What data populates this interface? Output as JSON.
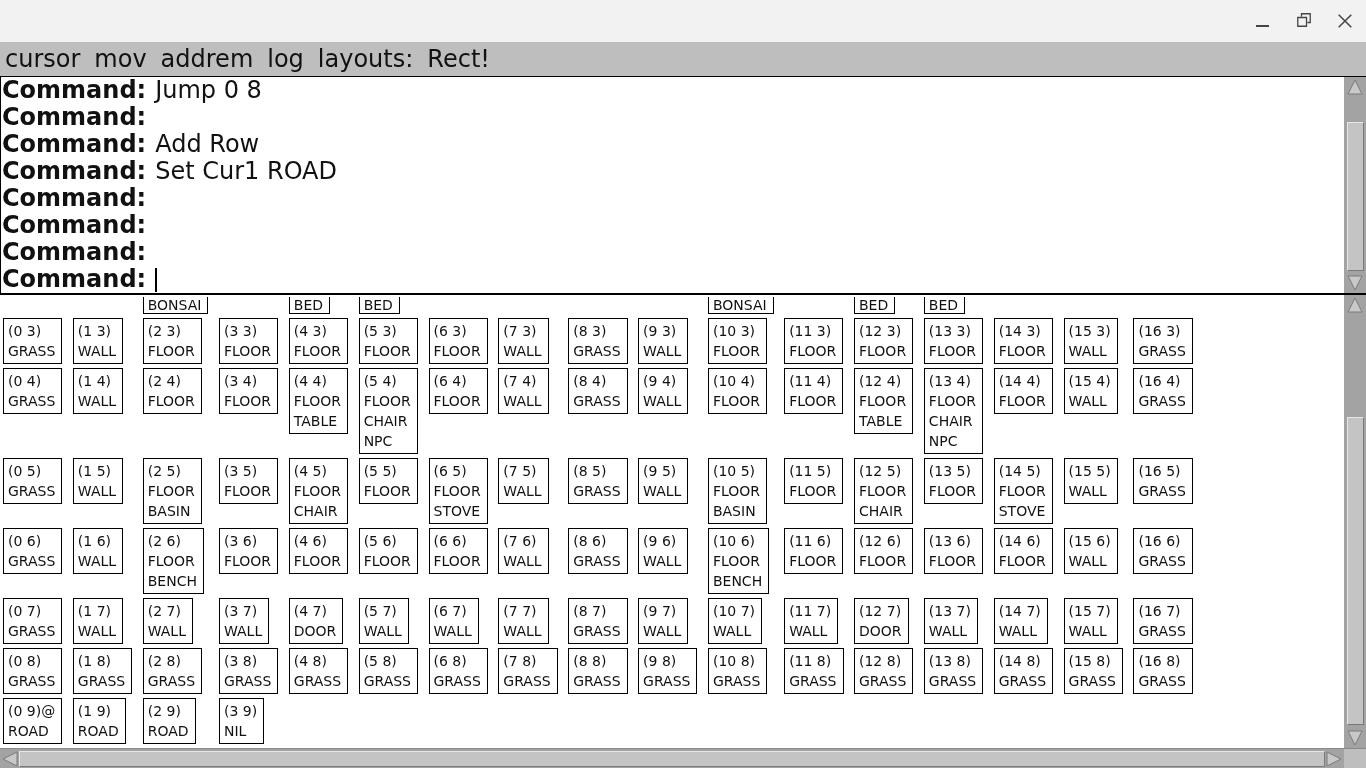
{
  "menu_bar": {
    "items": [
      {
        "label": "cursor"
      },
      {
        "label": "mov"
      },
      {
        "label": "addrem"
      },
      {
        "label": "log"
      },
      {
        "label": "layouts:"
      },
      {
        "label": "Rect!"
      }
    ]
  },
  "command_log": {
    "lines": [
      {
        "prompt": "Command:",
        "command": "Jump 0 8"
      },
      {
        "prompt": "Command:"
      },
      {
        "prompt": "Command:",
        "command": "Add Row"
      },
      {
        "prompt": "Command:",
        "command": "Set Cur1 ROAD"
      },
      {
        "prompt": "Command:"
      },
      {
        "prompt": "Command:"
      },
      {
        "prompt": "Command:"
      }
    ],
    "input": {
      "prompt": "Command:",
      "focused": true
    }
  },
  "map": {
    "rows": [
      [
        {
          "coords": "(0 3)",
          "lines": [
            "GRASS"
          ]
        },
        {
          "coords": "(1 3)",
          "lines": [
            "WALL"
          ]
        },
        {
          "coords": "(2 3)",
          "lines": [
            "FLOOR"
          ],
          "clipped_cell_above": {
            "lines": [
              "BONSAI"
            ]
          }
        },
        {
          "coords": "(3 3)",
          "lines": [
            "FLOOR"
          ]
        },
        {
          "coords": "(4 3)",
          "lines": [
            "FLOOR"
          ],
          "clipped_cell_above": {
            "lines": [
              "BED"
            ]
          }
        },
        {
          "coords": "(5 3)",
          "lines": [
            "FLOOR"
          ],
          "clipped_cell_above": {
            "lines": [
              "BED"
            ]
          }
        },
        {
          "coords": "(6 3)",
          "lines": [
            "FLOOR"
          ]
        },
        {
          "coords": "(7 3)",
          "lines": [
            "WALL"
          ]
        },
        {
          "coords": "(8 3)",
          "lines": [
            "GRASS"
          ]
        },
        {
          "coords": "(9 3)",
          "lines": [
            "WALL"
          ]
        },
        {
          "coords": "(10 3)",
          "lines": [
            "FLOOR"
          ],
          "clipped_cell_above": {
            "lines": [
              "BONSAI"
            ]
          }
        },
        {
          "coords": "(11 3)",
          "lines": [
            "FLOOR"
          ]
        },
        {
          "coords": "(12 3)",
          "lines": [
            "FLOOR"
          ],
          "clipped_cell_above": {
            "lines": [
              "BED"
            ]
          }
        },
        {
          "coords": "(13 3)",
          "lines": [
            "FLOOR"
          ],
          "clipped_cell_above": {
            "lines": [
              "BED"
            ]
          }
        },
        {
          "coords": "(14 3)",
          "lines": [
            "FLOOR"
          ]
        },
        {
          "coords": "(15 3)",
          "lines": [
            "WALL"
          ]
        },
        {
          "coords": "(16 3)",
          "lines": [
            "GRASS"
          ]
        }
      ],
      [
        {
          "coords": "(0 4)",
          "lines": [
            "GRASS"
          ]
        },
        {
          "coords": "(1 4)",
          "lines": [
            "WALL"
          ]
        },
        {
          "coords": "(2 4)",
          "lines": [
            "FLOOR"
          ]
        },
        {
          "coords": "(3 4)",
          "lines": [
            "FLOOR"
          ]
        },
        {
          "coords": "(4 4)",
          "lines": [
            "FLOOR",
            "TABLE"
          ]
        },
        {
          "coords": "(5 4)",
          "lines": [
            "FLOOR",
            "CHAIR",
            "NPC"
          ]
        },
        {
          "coords": "(6 4)",
          "lines": [
            "FLOOR"
          ]
        },
        {
          "coords": "(7 4)",
          "lines": [
            "WALL"
          ]
        },
        {
          "coords": "(8 4)",
          "lines": [
            "GRASS"
          ]
        },
        {
          "coords": "(9 4)",
          "lines": [
            "WALL"
          ]
        },
        {
          "coords": "(10 4)",
          "lines": [
            "FLOOR"
          ]
        },
        {
          "coords": "(11 4)",
          "lines": [
            "FLOOR"
          ]
        },
        {
          "coords": "(12 4)",
          "lines": [
            "FLOOR",
            "TABLE"
          ]
        },
        {
          "coords": "(13 4)",
          "lines": [
            "FLOOR",
            "CHAIR",
            "NPC"
          ]
        },
        {
          "coords": "(14 4)",
          "lines": [
            "FLOOR"
          ]
        },
        {
          "coords": "(15 4)",
          "lines": [
            "WALL"
          ]
        },
        {
          "coords": "(16 4)",
          "lines": [
            "GRASS"
          ]
        }
      ],
      [
        {
          "coords": "(0 5)",
          "lines": [
            "GRASS"
          ]
        },
        {
          "coords": "(1 5)",
          "lines": [
            "WALL"
          ]
        },
        {
          "coords": "(2 5)",
          "lines": [
            "FLOOR",
            "BASIN"
          ]
        },
        {
          "coords": "(3 5)",
          "lines": [
            "FLOOR"
          ]
        },
        {
          "coords": "(4 5)",
          "lines": [
            "FLOOR",
            "CHAIR"
          ]
        },
        {
          "coords": "(5 5)",
          "lines": [
            "FLOOR"
          ]
        },
        {
          "coords": "(6 5)",
          "lines": [
            "FLOOR",
            "STOVE"
          ]
        },
        {
          "coords": "(7 5)",
          "lines": [
            "WALL"
          ]
        },
        {
          "coords": "(8 5)",
          "lines": [
            "GRASS"
          ]
        },
        {
          "coords": "(9 5)",
          "lines": [
            "WALL"
          ]
        },
        {
          "coords": "(10 5)",
          "lines": [
            "FLOOR",
            "BASIN"
          ]
        },
        {
          "coords": "(11 5)",
          "lines": [
            "FLOOR"
          ]
        },
        {
          "coords": "(12 5)",
          "lines": [
            "FLOOR",
            "CHAIR"
          ]
        },
        {
          "coords": "(13 5)",
          "lines": [
            "FLOOR"
          ]
        },
        {
          "coords": "(14 5)",
          "lines": [
            "FLOOR",
            "STOVE"
          ]
        },
        {
          "coords": "(15 5)",
          "lines": [
            "WALL"
          ]
        },
        {
          "coords": "(16 5)",
          "lines": [
            "GRASS"
          ]
        }
      ],
      [
        {
          "coords": "(0 6)",
          "lines": [
            "GRASS"
          ]
        },
        {
          "coords": "(1 6)",
          "lines": [
            "WALL"
          ]
        },
        {
          "coords": "(2 6)",
          "lines": [
            "FLOOR",
            "BENCH"
          ]
        },
        {
          "coords": "(3 6)",
          "lines": [
            "FLOOR"
          ]
        },
        {
          "coords": "(4 6)",
          "lines": [
            "FLOOR"
          ]
        },
        {
          "coords": "(5 6)",
          "lines": [
            "FLOOR"
          ]
        },
        {
          "coords": "(6 6)",
          "lines": [
            "FLOOR"
          ]
        },
        {
          "coords": "(7 6)",
          "lines": [
            "WALL"
          ]
        },
        {
          "coords": "(8 6)",
          "lines": [
            "GRASS"
          ]
        },
        {
          "coords": "(9 6)",
          "lines": [
            "WALL"
          ]
        },
        {
          "coords": "(10 6)",
          "lines": [
            "FLOOR",
            "BENCH"
          ]
        },
        {
          "coords": "(11 6)",
          "lines": [
            "FLOOR"
          ]
        },
        {
          "coords": "(12 6)",
          "lines": [
            "FLOOR"
          ]
        },
        {
          "coords": "(13 6)",
          "lines": [
            "FLOOR"
          ]
        },
        {
          "coords": "(14 6)",
          "lines": [
            "FLOOR"
          ]
        },
        {
          "coords": "(15 6)",
          "lines": [
            "WALL"
          ]
        },
        {
          "coords": "(16 6)",
          "lines": [
            "GRASS"
          ]
        }
      ],
      [
        {
          "coords": "(0 7)",
          "lines": [
            "GRASS"
          ]
        },
        {
          "coords": "(1 7)",
          "lines": [
            "WALL"
          ]
        },
        {
          "coords": "(2 7)",
          "lines": [
            "WALL"
          ]
        },
        {
          "coords": "(3 7)",
          "lines": [
            "WALL"
          ]
        },
        {
          "coords": "(4 7)",
          "lines": [
            "DOOR"
          ]
        },
        {
          "coords": "(5 7)",
          "lines": [
            "WALL"
          ]
        },
        {
          "coords": "(6 7)",
          "lines": [
            "WALL"
          ]
        },
        {
          "coords": "(7 7)",
          "lines": [
            "WALL"
          ]
        },
        {
          "coords": "(8 7)",
          "lines": [
            "GRASS"
          ]
        },
        {
          "coords": "(9 7)",
          "lines": [
            "WALL"
          ]
        },
        {
          "coords": "(10 7)",
          "lines": [
            "WALL"
          ]
        },
        {
          "coords": "(11 7)",
          "lines": [
            "WALL"
          ]
        },
        {
          "coords": "(12 7)",
          "lines": [
            "DOOR"
          ]
        },
        {
          "coords": "(13 7)",
          "lines": [
            "WALL"
          ]
        },
        {
          "coords": "(14 7)",
          "lines": [
            "WALL"
          ]
        },
        {
          "coords": "(15 7)",
          "lines": [
            "WALL"
          ]
        },
        {
          "coords": "(16 7)",
          "lines": [
            "GRASS"
          ]
        }
      ],
      [
        {
          "coords": "(0 8)",
          "lines": [
            "GRASS"
          ]
        },
        {
          "coords": "(1 8)",
          "lines": [
            "GRASS"
          ]
        },
        {
          "coords": "(2 8)",
          "lines": [
            "GRASS"
          ]
        },
        {
          "coords": "(3 8)",
          "lines": [
            "GRASS"
          ]
        },
        {
          "coords": "(4 8)",
          "lines": [
            "GRASS"
          ]
        },
        {
          "coords": "(5 8)",
          "lines": [
            "GRASS"
          ]
        },
        {
          "coords": "(6 8)",
          "lines": [
            "GRASS"
          ]
        },
        {
          "coords": "(7 8)",
          "lines": [
            "GRASS"
          ]
        },
        {
          "coords": "(8 8)",
          "lines": [
            "GRASS"
          ]
        },
        {
          "coords": "(9 8)",
          "lines": [
            "GRASS"
          ]
        },
        {
          "coords": "(10 8)",
          "lines": [
            "GRASS"
          ]
        },
        {
          "coords": "(11 8)",
          "lines": [
            "GRASS"
          ]
        },
        {
          "coords": "(12 8)",
          "lines": [
            "GRASS"
          ]
        },
        {
          "coords": "(13 8)",
          "lines": [
            "GRASS"
          ]
        },
        {
          "coords": "(14 8)",
          "lines": [
            "GRASS"
          ]
        },
        {
          "coords": "(15 8)",
          "lines": [
            "GRASS"
          ]
        },
        {
          "coords": "(16 8)",
          "lines": [
            "GRASS"
          ]
        }
      ],
      [
        {
          "coords": "(0 9)@",
          "lines": [
            "ROAD"
          ]
        },
        {
          "coords": "(1 9)",
          "lines": [
            "ROAD"
          ]
        },
        {
          "coords": "(2 9)",
          "lines": [
            "ROAD"
          ]
        },
        {
          "coords": "(3 9)",
          "lines": [
            "NIL"
          ]
        }
      ]
    ]
  }
}
